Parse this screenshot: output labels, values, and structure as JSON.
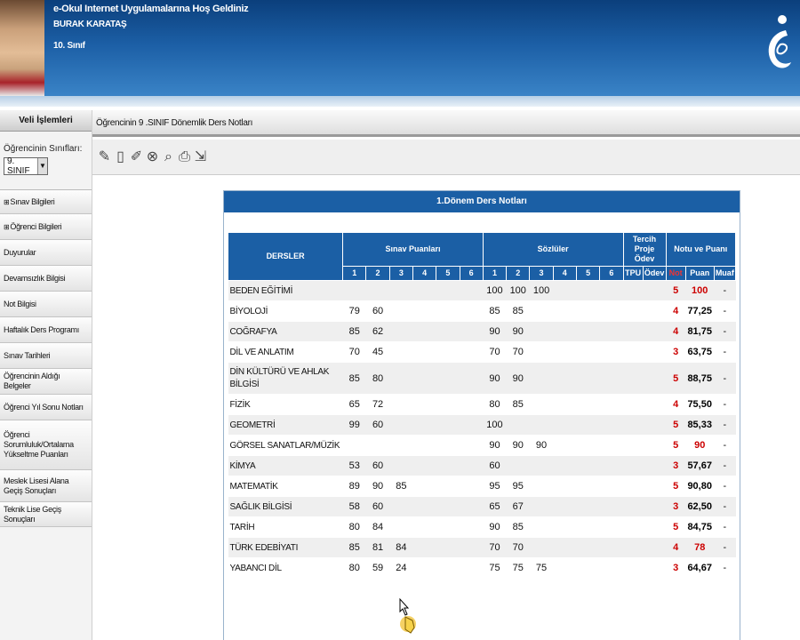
{
  "header": {
    "welcome": "e-Okul Internet Uygulamalarına Hoş Geldiniz",
    "student_name": "BURAK KARATAŞ",
    "student_class": "10. Sınıf",
    "logo_icon": "e-okul-logo"
  },
  "sidebar": {
    "title": "Veli İşlemleri",
    "class_label": "Öğrencinin Sınıfları:",
    "class_selected": "9. SINIF",
    "items": [
      {
        "label": "Sınav Bilgileri"
      },
      {
        "label": "Öğrenci Bilgileri"
      },
      {
        "label": "Duyurular"
      },
      {
        "label": "Devamsızlık Bilgisi"
      },
      {
        "label": "Not Bilgisi"
      },
      {
        "label": "Haftalık Ders Programı"
      },
      {
        "label": "Sınav Tarihleri"
      },
      {
        "label": "Öğrencinin Aldığı Belgeler"
      },
      {
        "label": "Öğrenci Yıl Sonu Notları"
      },
      {
        "label": "Öğrenci Sorumluluk/Ortalama Yükseltme Puanları"
      },
      {
        "label": "Meslek Lisesi Alana Geçiş Sonuçları"
      },
      {
        "label": "Teknik Lise Geçiş Sonuçları"
      }
    ]
  },
  "page": {
    "title": "Öğrencinin 9 .SINIF Dönemlik Ders Notları"
  },
  "toolbar": {
    "icons": [
      "edit-icon",
      "clipboard-icon",
      "pen-icon",
      "cancel-icon",
      "search-icon",
      "print-icon",
      "export-icon"
    ]
  },
  "grades": {
    "title": "1.Dönem Ders Notları",
    "headers": {
      "subjects": "DERSLER",
      "exams": "Sınav Puanları",
      "oral": "Sözlüler",
      "project": "Tercih Proje Ödev",
      "result": "Notu ve Puanı",
      "tpu": "TPU",
      "odev": "Ödev",
      "not": "Not",
      "puan": "Puan",
      "muaf": "Muaf",
      "exam_cols": [
        "1",
        "2",
        "3",
        "4",
        "5",
        "6"
      ],
      "oral_cols": [
        "1",
        "2",
        "3",
        "4",
        "5",
        "6"
      ]
    },
    "rows": [
      {
        "ders": "BEDEN EĞİTİMİ",
        "sinav": [
          "",
          "",
          "",
          "",
          "",
          ""
        ],
        "sozlu": [
          "100",
          "100",
          "100",
          "",
          "",
          ""
        ],
        "tpu": "",
        "odev": "",
        "not": "5",
        "puan": "100",
        "muaf": "-"
      },
      {
        "ders": "BİYOLOJİ",
        "sinav": [
          "79",
          "60",
          "",
          "",
          "",
          ""
        ],
        "sozlu": [
          "85",
          "85",
          "",
          "",
          "",
          ""
        ],
        "tpu": "",
        "odev": "",
        "not": "4",
        "puan": "77,25",
        "muaf": "-"
      },
      {
        "ders": "COĞRAFYA",
        "sinav": [
          "85",
          "62",
          "",
          "",
          "",
          ""
        ],
        "sozlu": [
          "90",
          "90",
          "",
          "",
          "",
          ""
        ],
        "tpu": "",
        "odev": "",
        "not": "4",
        "puan": "81,75",
        "muaf": "-"
      },
      {
        "ders": "DİL VE ANLATIM",
        "sinav": [
          "70",
          "45",
          "",
          "",
          "",
          ""
        ],
        "sozlu": [
          "70",
          "70",
          "",
          "",
          "",
          ""
        ],
        "tpu": "",
        "odev": "",
        "not": "3",
        "puan": "63,75",
        "muaf": "-"
      },
      {
        "ders": "DİN KÜLTÜRÜ VE AHLAK BİLGİSİ",
        "sinav": [
          "85",
          "80",
          "",
          "",
          "",
          ""
        ],
        "sozlu": [
          "90",
          "90",
          "",
          "",
          "",
          ""
        ],
        "tpu": "",
        "odev": "",
        "not": "5",
        "puan": "88,75",
        "muaf": "-"
      },
      {
        "ders": "FİZİK",
        "sinav": [
          "65",
          "72",
          "",
          "",
          "",
          ""
        ],
        "sozlu": [
          "80",
          "85",
          "",
          "",
          "",
          ""
        ],
        "tpu": "",
        "odev": "",
        "not": "4",
        "puan": "75,50",
        "muaf": "-"
      },
      {
        "ders": "GEOMETRİ",
        "sinav": [
          "99",
          "60",
          "",
          "",
          "",
          ""
        ],
        "sozlu": [
          "100",
          "",
          "",
          "",
          "",
          ""
        ],
        "tpu": "",
        "odev": "",
        "not": "5",
        "puan": "85,33",
        "muaf": "-"
      },
      {
        "ders": "GÖRSEL SANATLAR/MÜZİK",
        "sinav": [
          "",
          "",
          "",
          "",
          "",
          ""
        ],
        "sozlu": [
          "90",
          "90",
          "90",
          "",
          "",
          ""
        ],
        "tpu": "",
        "odev": "",
        "not": "5",
        "puan": "90",
        "muaf": "-"
      },
      {
        "ders": "KİMYA",
        "sinav": [
          "53",
          "60",
          "",
          "",
          "",
          ""
        ],
        "sozlu": [
          "60",
          "",
          "",
          "",
          "",
          ""
        ],
        "tpu": "",
        "odev": "",
        "not": "3",
        "puan": "57,67",
        "muaf": "-"
      },
      {
        "ders": "MATEMATİK",
        "sinav": [
          "89",
          "90",
          "85",
          "",
          "",
          ""
        ],
        "sozlu": [
          "95",
          "95",
          "",
          "",
          "",
          ""
        ],
        "tpu": "",
        "odev": "",
        "not": "5",
        "puan": "90,80",
        "muaf": "-"
      },
      {
        "ders": "SAĞLIK BİLGİSİ",
        "sinav": [
          "58",
          "60",
          "",
          "",
          "",
          ""
        ],
        "sozlu": [
          "65",
          "67",
          "",
          "",
          "",
          ""
        ],
        "tpu": "",
        "odev": "",
        "not": "3",
        "puan": "62,50",
        "muaf": "-"
      },
      {
        "ders": "TARİH",
        "sinav": [
          "80",
          "84",
          "",
          "",
          "",
          ""
        ],
        "sozlu": [
          "90",
          "85",
          "",
          "",
          "",
          ""
        ],
        "tpu": "",
        "odev": "",
        "not": "5",
        "puan": "84,75",
        "muaf": "-"
      },
      {
        "ders": "TÜRK EDEBİYATI",
        "sinav": [
          "85",
          "81",
          "84",
          "",
          "",
          ""
        ],
        "sozlu": [
          "70",
          "70",
          "",
          "",
          "",
          ""
        ],
        "tpu": "",
        "odev": "",
        "not": "4",
        "puan": "78",
        "muaf": "-"
      },
      {
        "ders": "YABANCI DİL",
        "sinav": [
          "80",
          "59",
          "24",
          "",
          "",
          ""
        ],
        "sozlu": [
          "75",
          "75",
          "75",
          "",
          "",
          ""
        ],
        "tpu": "",
        "odev": "",
        "not": "3",
        "puan": "64,67",
        "muaf": "-"
      }
    ]
  }
}
